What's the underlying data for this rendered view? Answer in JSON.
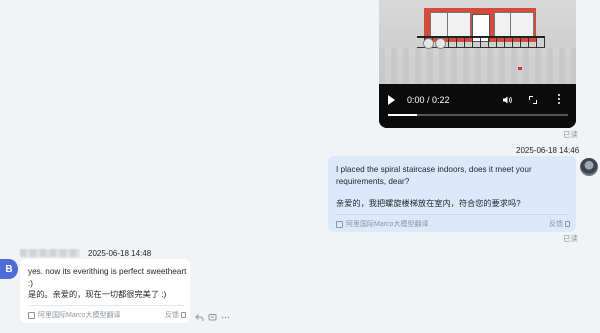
{
  "video": {
    "current_time": "0:00",
    "duration": "0:22",
    "time_display": "0:00 / 0:22",
    "progress": 0.16,
    "icons": [
      "play-icon",
      "volume-icon",
      "fullscreen-icon",
      "more-vertical-icon"
    ]
  },
  "read_receipt": "已读",
  "outgoing": {
    "timestamp": "2025-06-18 14:46",
    "text_en_line1": "I placed the spiral staircase indoors, does it meet your",
    "text_en_line2": "requirements, dear?",
    "text_zh": "亲爱的，我把螺旋楼梯放在室内，符合您的要求吗?",
    "translation_label": "阿里国际Marco大模型翻译",
    "feedback_label": "反馈",
    "read": "已读"
  },
  "incoming": {
    "avatar_letter": "B",
    "timestamp": "2025-06-18 14:48",
    "text_en": "yes. now its everithing is perfect sweetheart :)",
    "text_zh": "是的。亲爱的，现在一切都很完美了 :)",
    "translation_label": "阿里国际Marco大模型翻译",
    "feedback_label": "反馈"
  },
  "colors": {
    "background": "#f2f3f5",
    "outgoing_bubble": "#dce9fb",
    "incoming_bubble": "#ffffff",
    "avatar_b": "#4f6bd8",
    "muted_text": "#8f959e"
  }
}
